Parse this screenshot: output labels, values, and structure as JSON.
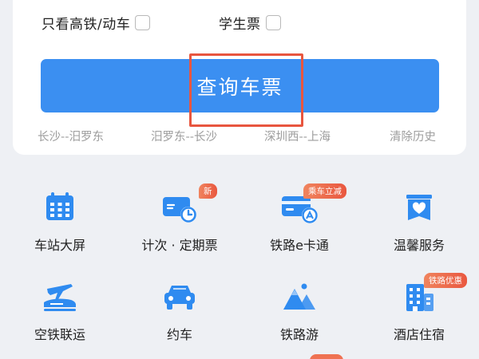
{
  "options": {
    "gaotie_label": "只看高铁/动车",
    "student_label": "学生票",
    "gaotie_checked": false,
    "student_checked": false
  },
  "query_button": "查询车票",
  "history": [
    "长沙--汨罗东",
    "汨罗东--长沙",
    "深圳西--上海",
    "清除历史"
  ],
  "services": [
    {
      "label": "车站大屏",
      "icon": "station-screen-icon"
    },
    {
      "label": "计次 · 定期票",
      "icon": "ticket-card-icon",
      "badge": "新"
    },
    {
      "label": "铁路e卡通",
      "icon": "e-card-icon",
      "badge": "乘车立减"
    },
    {
      "label": "温馨服务",
      "icon": "heart-service-icon"
    },
    {
      "label": "空铁联运",
      "icon": "air-rail-icon"
    },
    {
      "label": "约车",
      "icon": "car-icon"
    },
    {
      "label": "铁路游",
      "icon": "mountain-tour-icon"
    },
    {
      "label": "酒店住宿",
      "icon": "hotel-icon",
      "badge": "铁路优惠"
    }
  ],
  "colors": {
    "primary": "#3b8ff1",
    "icon_blue": "#2f8bf0",
    "highlight": "#e8563f",
    "badge": "#ec6a4a"
  }
}
